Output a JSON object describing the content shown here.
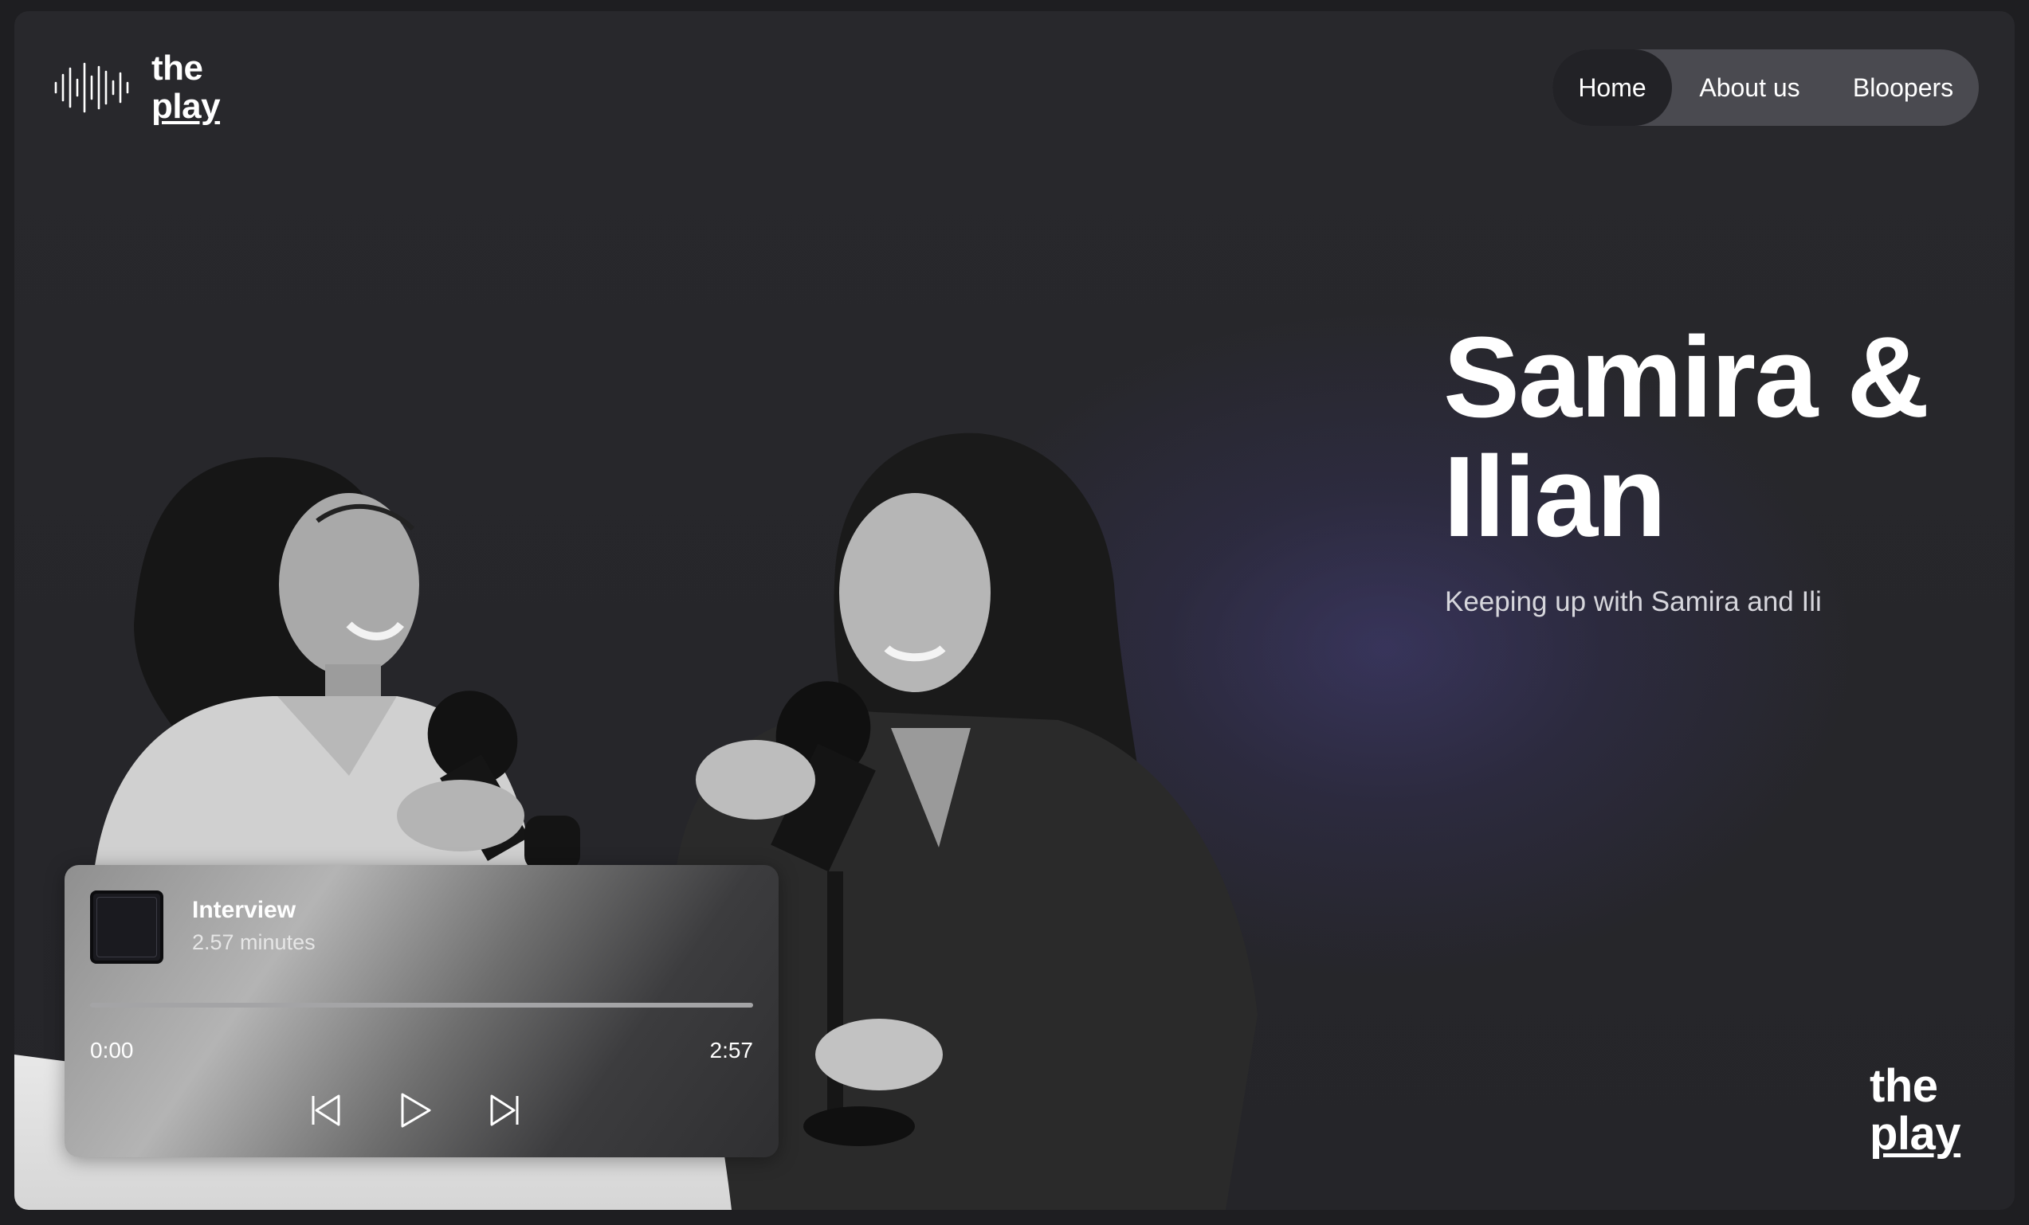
{
  "brand": {
    "logo_line1": "the",
    "logo_line2": "play",
    "logo_icon": "soundwave-icon"
  },
  "nav": {
    "items": [
      {
        "label": "Home",
        "active": true
      },
      {
        "label": "About us",
        "active": false
      },
      {
        "label": "Bloopers",
        "active": false
      }
    ]
  },
  "hero": {
    "title": "Samira & Ilian",
    "subtitle": "Keeping up with Samira and Ili"
  },
  "player": {
    "track_title": "Interview",
    "track_duration_text": "2.57 minutes",
    "time_current": "0:00",
    "time_total": "2:57",
    "progress": 0,
    "controls": {
      "previous_icon": "skip-back-icon",
      "play_icon": "play-icon",
      "next_icon": "skip-forward-icon"
    }
  },
  "footer": {
    "logo_line1": "the",
    "logo_line2": "play"
  },
  "colors": {
    "background": "#1e1e21",
    "panel": "#28282c",
    "nav_pill": "#4a4a50",
    "nav_active": "#222226",
    "glow": "#464082",
    "text": "#ffffff"
  }
}
